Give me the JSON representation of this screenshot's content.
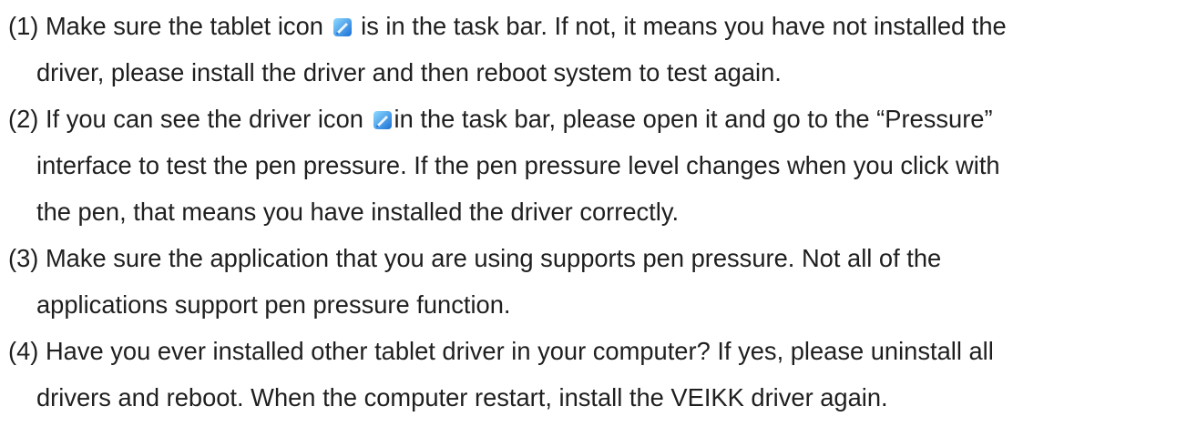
{
  "items": [
    {
      "lines": [
        "(1) Make sure the tablet icon",
        "is in the task bar. If not, it means you have not installed the",
        "driver, please install the driver and then reboot system to test again."
      ],
      "icon": "tablet-driver-icon"
    },
    {
      "lines": [
        "(2) If you can see the driver icon",
        "in the task bar, please open it and go to the “Pressure”",
        "interface to test the pen pressure. If the pen pressure level changes when you click with",
        "the pen, that means you have installed the driver correctly."
      ],
      "icon": "tablet-driver-icon"
    },
    {
      "lines": [
        "(3) Make sure the application that you are using supports pen pressure. Not all of the",
        "applications support pen pressure function."
      ]
    },
    {
      "lines": [
        "(4) Have you ever installed other tablet driver in your computer? If yes, please uninstall all",
        "drivers and reboot. When the computer restart, install the VEIKK driver again."
      ]
    }
  ],
  "colors": {
    "text": "#1f1f1f",
    "icon_dark": "#1a6fd6",
    "icon_light": "#7fd0f7",
    "background": "#ffffff"
  }
}
